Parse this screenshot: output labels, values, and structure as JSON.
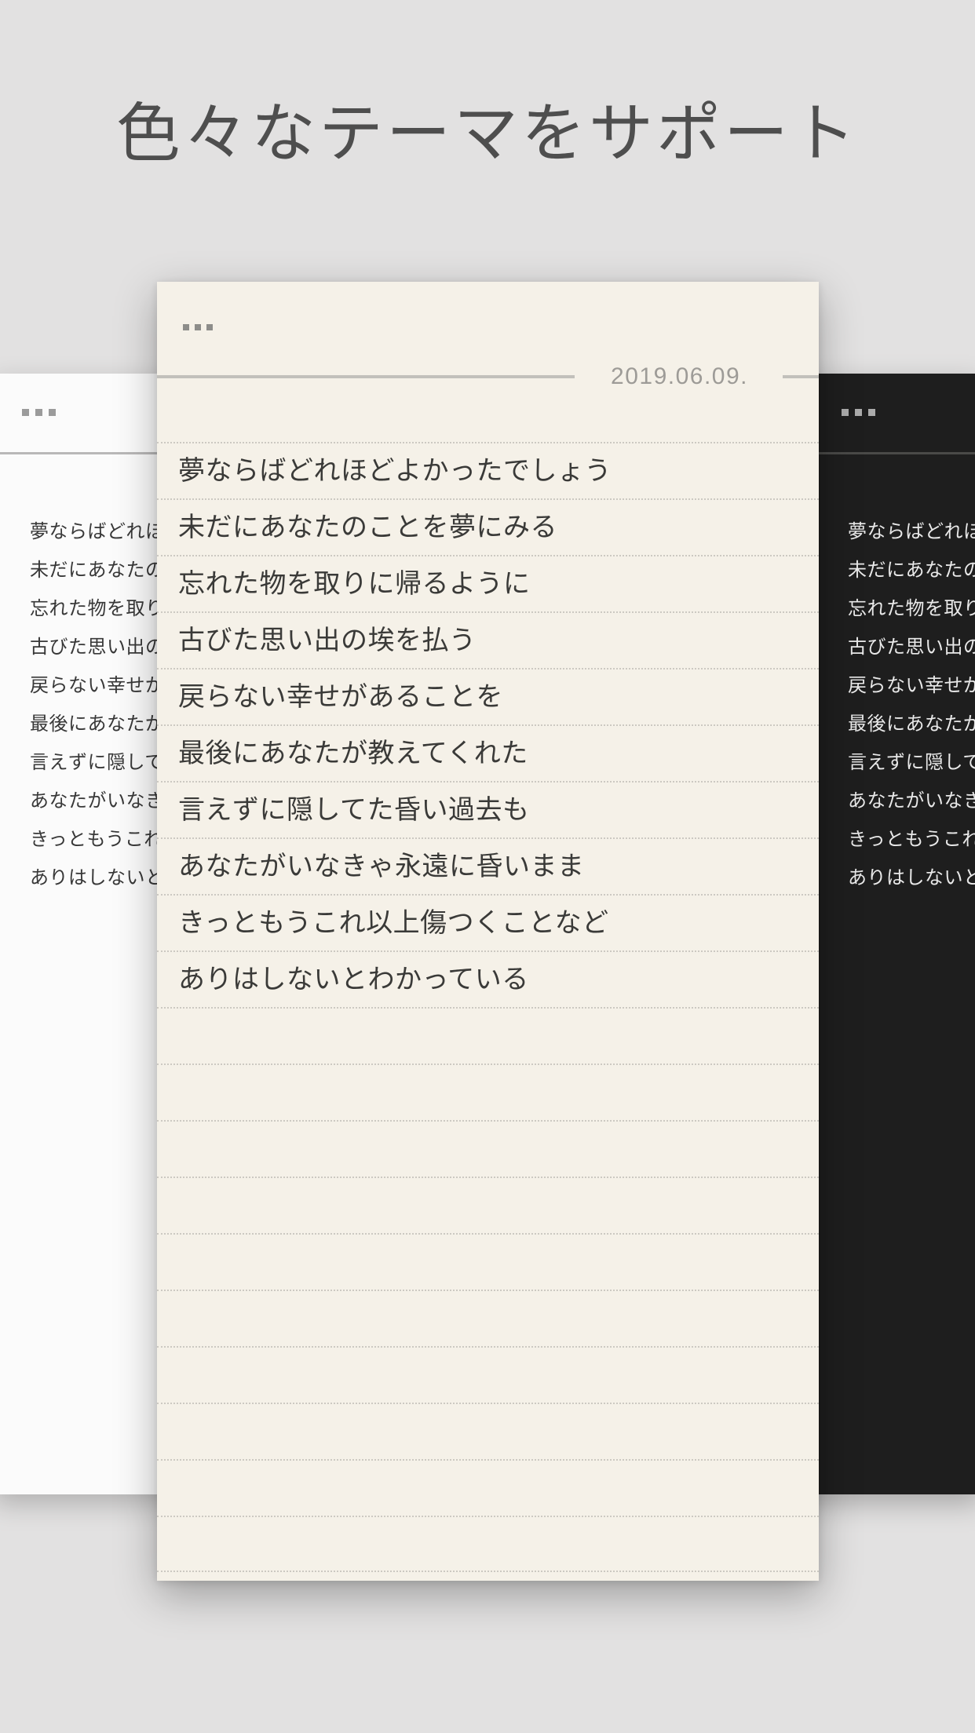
{
  "page": {
    "title": "色々なテーマをサポート",
    "background": "#e2e1e1",
    "title_color": "#4e4e4e"
  },
  "note": {
    "date": "2019.06.09.",
    "lines": [
      "夢ならばどれほどよかったでしょう",
      "未だにあなたのことを夢にみる",
      "忘れた物を取りに帰るように",
      "古びた思い出の埃を払う",
      "戻らない幸せがあることを",
      "最後にあなたが教えてくれた",
      "言えずに隠してた昏い過去も",
      "あなたがいなきゃ永遠に昏いまま",
      "きっともうこれ以上傷つくことなど",
      "ありはしないとわかっている"
    ]
  },
  "themes": {
    "light": {
      "name": "light",
      "background": "#fbfbfb",
      "text_color": "#383838"
    },
    "paper": {
      "name": "paper",
      "background": "#f5f1e8",
      "text_color": "#3a3a38",
      "rule_color": "#ccc9c2",
      "divider_color": "#c2c0bb",
      "date_color": "#9d9b97"
    },
    "dark": {
      "name": "dark",
      "background": "#1e1e1e",
      "text_color": "#e9e9e9"
    }
  },
  "icons": {
    "menu": "ellipsis-menu-icon"
  }
}
